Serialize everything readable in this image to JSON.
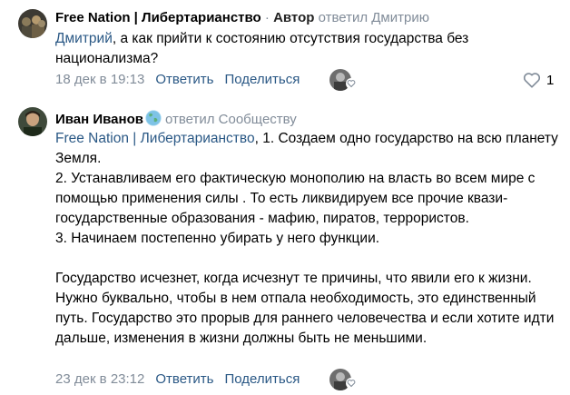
{
  "comments": [
    {
      "author": "Free Nation | Либертарианство",
      "separator": " · ",
      "role": "Автор",
      "reply_to": "ответил Дмитрию",
      "mention": "Дмитрий",
      "text": ", а как прийти к состоянию отсутствия государства без национализма?",
      "date": "18 дек в 19:13",
      "reply_label": "Ответить",
      "share_label": "Поделиться",
      "like_count": "1"
    },
    {
      "author": "Иван Иванов",
      "reply_to": "ответил Сообществу",
      "mention": "Free Nation | Либертарианство",
      "text": ", 1. Создаем одно государство на всю планету Земля.\n2. Устанавливаем его фактическую монополию на власть во всем мире с помощью применения силы . То есть ликвидируем все прочие квази-государственные образования - мафию, пиратов, террористов.\n3. Начинаем постепенно убирать у него функции.\n\nГосударство исчезнет, когда исчезнут те причины, что явили его к жизни. Нужно буквально, чтобы в нем отпала необходимость, это единственный путь. Государство это прорыв для раннего человечества и если хотите идти дальше, изменения в жизни должны быть не меньшими.",
      "date": "23 дек в 23:12",
      "reply_label": "Ответить",
      "share_label": "Поделиться"
    }
  ],
  "icons": {
    "like": "heart-icon",
    "liked_by": "liker-avatar",
    "badge": "globe-icon"
  },
  "colors": {
    "link": "#2a5885",
    "muted": "#818c99",
    "text": "#000000"
  }
}
